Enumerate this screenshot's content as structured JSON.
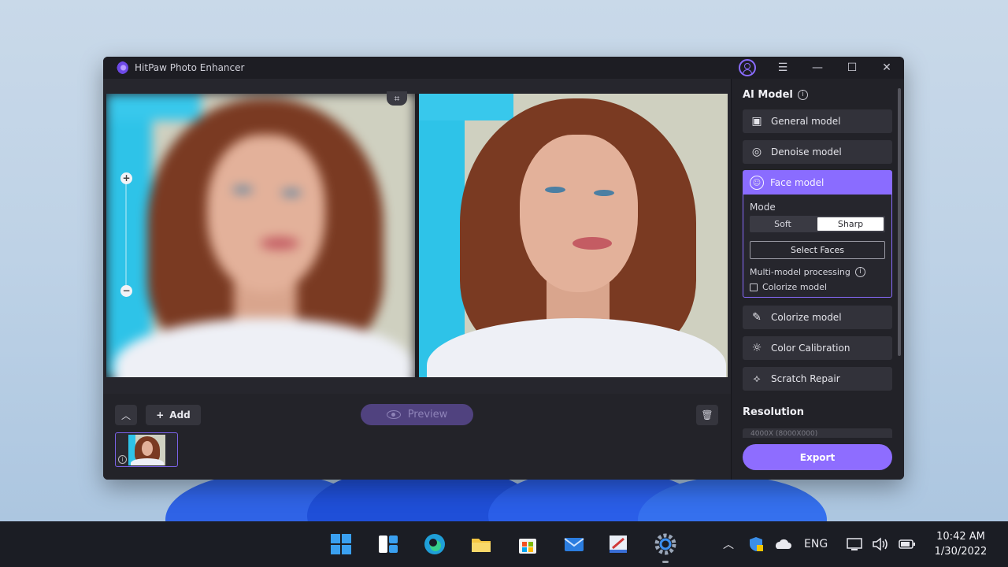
{
  "app": {
    "title": "HitPaw Photo Enhancer"
  },
  "window_controls": [
    "user-icon",
    "menu-icon",
    "minimize-icon",
    "maximize-icon",
    "close-icon"
  ],
  "toolbar": {
    "add_label": "Add",
    "preview_label": "Preview"
  },
  "panel": {
    "ai_model_title": "AI Model",
    "models": [
      {
        "label": "General model",
        "icon": "image-icon"
      },
      {
        "label": "Denoise model",
        "icon": "denoise-icon"
      },
      {
        "label": "Face model",
        "icon": "face-icon",
        "selected": true
      },
      {
        "label": "Colorize model",
        "icon": "colorize-icon"
      },
      {
        "label": "Color Calibration",
        "icon": "calibration-icon"
      },
      {
        "label": "Scratch Repair",
        "icon": "scratch-icon"
      }
    ],
    "face": {
      "mode_label": "Mode",
      "mode_options": [
        "Soft",
        "Sharp"
      ],
      "mode_selected": "Sharp",
      "select_faces_label": "Select Faces",
      "multi_label": "Multi-model processing",
      "colorize_checkbox_label": "Colorize model",
      "colorize_checked": false
    },
    "resolution_title": "Resolution",
    "resolution_value": "4000X (8000X000)",
    "export_label": "Export"
  },
  "taskbar": {
    "apps": [
      "windows-start-icon",
      "widgets-icon",
      "edge-icon",
      "file-explorer-icon",
      "store-icon",
      "mail-icon",
      "paint-icon",
      "settings-icon"
    ],
    "language": "ENG",
    "time": "10:42 AM",
    "date": "1/30/2022"
  },
  "colors": {
    "accent": "#8a6cff",
    "window_bg": "#1d1d23",
    "taskbar_bg": "#1b1d24"
  }
}
